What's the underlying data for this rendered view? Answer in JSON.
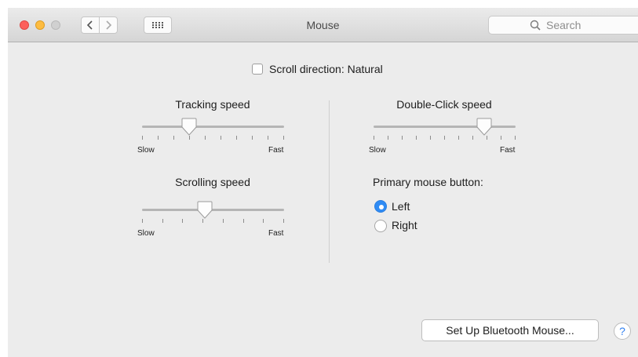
{
  "window": {
    "title": "Mouse",
    "search_placeholder": "Search"
  },
  "scroll_direction": {
    "label": "Scroll direction: Natural",
    "checked": false
  },
  "tracking_speed": {
    "label": "Tracking speed",
    "min_label": "Slow",
    "max_label": "Fast",
    "level": 0.33,
    "tick_count": 10
  },
  "scrolling_speed": {
    "label": "Scrolling speed",
    "min_label": "Slow",
    "max_label": "Fast",
    "level": 0.44,
    "tick_count": 8
  },
  "double_click_speed": {
    "label": "Double-Click speed",
    "min_label": "Slow",
    "max_label": "Fast",
    "level": 0.78,
    "tick_count": 11
  },
  "primary_mouse_button": {
    "label": "Primary mouse button:",
    "options": [
      {
        "label": "Left",
        "selected": true
      },
      {
        "label": "Right",
        "selected": false
      }
    ]
  },
  "buttons": {
    "bluetooth": "Set Up Bluetooth Mouse...",
    "help": "?"
  },
  "colors": {
    "accent": "#2f8bf4",
    "close": "#fc605c",
    "minimize": "#fdbc40"
  }
}
